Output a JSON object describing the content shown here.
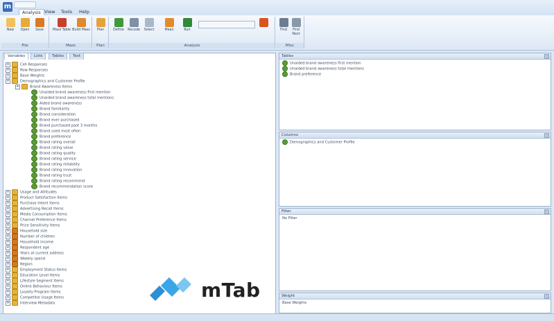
{
  "app": {
    "logo_letter": "m"
  },
  "menu": {
    "items": [
      "Analysis",
      "View",
      "Tools",
      "Help"
    ]
  },
  "ribbon": {
    "groups": [
      {
        "label": "File",
        "buttons": [
          "New",
          "Open",
          "Save"
        ]
      },
      {
        "label": "Mass",
        "buttons": [
          "Mass Table",
          "Build Mass"
        ]
      },
      {
        "label": "Plan",
        "buttons": [
          "Plan"
        ]
      },
      {
        "label": "Analysis",
        "buttons": [
          "Define",
          "Recode",
          "Select",
          "Mean",
          "Run"
        ]
      },
      {
        "label": "Misc",
        "buttons": [
          "Find",
          "Find Next"
        ]
      }
    ],
    "colors": {
      "blue": "#3b6db3",
      "green": "#3d9a3a",
      "orange": "#d97a22",
      "red": "#c8402c"
    }
  },
  "left_tabs": [
    "Variables",
    "Lists",
    "Tables",
    "Text"
  ],
  "tree": [
    {
      "level": 0,
      "type": "folder",
      "label": "Cell Responses"
    },
    {
      "level": 0,
      "type": "folder",
      "label": "Row Responses"
    },
    {
      "level": 0,
      "type": "folder",
      "label": "Base Weights"
    },
    {
      "level": 0,
      "type": "folder",
      "label": "Demographics and Customer Profile"
    },
    {
      "level": 1,
      "type": "expander",
      "label": "Brand Awareness Items"
    },
    {
      "level": 2,
      "type": "dep",
      "label": "Unaided brand awareness first mention"
    },
    {
      "level": 2,
      "type": "dep",
      "label": "Unaided brand awareness total mentions"
    },
    {
      "level": 2,
      "type": "dep",
      "label": "Aided brand awareness"
    },
    {
      "level": 2,
      "type": "dep",
      "label": "Brand familiarity"
    },
    {
      "level": 2,
      "type": "dep",
      "label": "Brand consideration"
    },
    {
      "level": 2,
      "type": "dep",
      "label": "Brand ever purchased"
    },
    {
      "level": 2,
      "type": "dep",
      "label": "Brand purchased past 3 months"
    },
    {
      "level": 2,
      "type": "dep",
      "label": "Brand used most often"
    },
    {
      "level": 2,
      "type": "dep",
      "label": "Brand preference"
    },
    {
      "level": 2,
      "type": "dep",
      "label": "Brand rating overall"
    },
    {
      "level": 2,
      "type": "dep",
      "label": "Brand rating value"
    },
    {
      "level": 2,
      "type": "dep",
      "label": "Brand rating quality"
    },
    {
      "level": 2,
      "type": "dep",
      "label": "Brand rating service"
    },
    {
      "level": 2,
      "type": "dep",
      "label": "Brand rating reliability"
    },
    {
      "level": 2,
      "type": "dep",
      "label": "Brand rating innovation"
    },
    {
      "level": 2,
      "type": "dep",
      "label": "Brand rating trust"
    },
    {
      "level": 2,
      "type": "dep",
      "label": "Brand rating recommend"
    },
    {
      "level": 2,
      "type": "dep",
      "label": "Brand recommendation score"
    },
    {
      "level": 0,
      "type": "folder",
      "label": "Usage and Attitudes"
    },
    {
      "level": 0,
      "type": "folder",
      "label": "Product Satisfaction Items"
    },
    {
      "level": 0,
      "type": "folder",
      "label": "Purchase Intent Items"
    },
    {
      "level": 0,
      "type": "folder",
      "label": "Advertising Recall Items"
    },
    {
      "level": 0,
      "type": "folder",
      "label": "Media Consumption Items"
    },
    {
      "level": 0,
      "type": "folder",
      "label": "Channel Preference Items"
    },
    {
      "level": 0,
      "type": "folder",
      "label": "Price Sensitivity Items"
    },
    {
      "level": 0,
      "type": "num",
      "label": "Household size"
    },
    {
      "level": 0,
      "type": "num",
      "label": "Number of children"
    },
    {
      "level": 0,
      "type": "num",
      "label": "Household income"
    },
    {
      "level": 0,
      "type": "num",
      "label": "Respondent age"
    },
    {
      "level": 0,
      "type": "num",
      "label": "Years at current address"
    },
    {
      "level": 0,
      "type": "num",
      "label": "Weekly spend"
    },
    {
      "level": 0,
      "type": "num",
      "label": "Region"
    },
    {
      "level": 0,
      "type": "folder",
      "label": "Employment Status Items"
    },
    {
      "level": 0,
      "type": "folder",
      "label": "Education Level Items"
    },
    {
      "level": 0,
      "type": "folder",
      "label": "Lifestyle Segment Items"
    },
    {
      "level": 0,
      "type": "folder",
      "label": "Online Behaviour Items"
    },
    {
      "level": 0,
      "type": "folder",
      "label": "Loyalty Program Items"
    },
    {
      "level": 0,
      "type": "folder",
      "label": "Competitor Usage Items"
    },
    {
      "level": 0,
      "type": "folder",
      "label": "Interview Metadata"
    }
  ],
  "panels": {
    "tables": {
      "title": "Tables",
      "rows": [
        "Unaided brand awareness first mention",
        "Unaided brand awareness total mentions",
        "Brand preference"
      ]
    },
    "columns": {
      "title": "Columns",
      "rows": [
        "Demographics and Customer Profile"
      ]
    },
    "filter": {
      "title": "Filter",
      "rows": [
        "No Filter"
      ]
    },
    "weight": {
      "title": "Weight",
      "summary": "Base Weights",
      "footer": ""
    }
  },
  "brand": {
    "name": "mTab"
  }
}
